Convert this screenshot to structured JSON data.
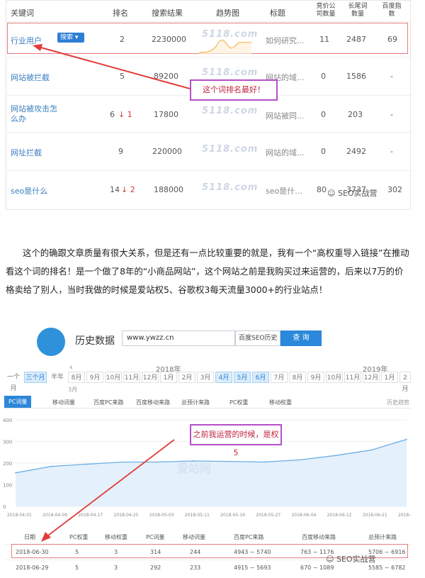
{
  "keyword_table": {
    "headers": [
      "关键词",
      "排名",
      "搜索结果",
      "趋势图",
      "标题",
      "竞价公司数量",
      "长尾词数量",
      "百度指数"
    ],
    "search_button": "搜索 ▾",
    "watermark": "5118.com",
    "rows": [
      {
        "keyword": "行业用户",
        "rank": "2",
        "change": "",
        "results": "2230000",
        "title": "如何研究...",
        "bid": "11",
        "longtail": "2487",
        "index": "69"
      },
      {
        "keyword": "网站被拦截",
        "rank": "5",
        "change": "",
        "results": "89200",
        "title": "网站的域...",
        "bid": "0",
        "longtail": "1586",
        "index": "-"
      },
      {
        "keyword": "网站被攻击怎么办",
        "rank": "6",
        "change": "↓ 1",
        "results": "17800",
        "title": "网站被同...",
        "bid": "0",
        "longtail": "203",
        "index": "-"
      },
      {
        "keyword": "网址拦截",
        "rank": "9",
        "change": "",
        "results": "220000",
        "title": "网站的域...",
        "bid": "0",
        "longtail": "2492",
        "index": "-"
      },
      {
        "keyword": "seo是什么",
        "rank": "14",
        "change": "↓ 2",
        "results": "188000",
        "title": "seo是什...",
        "bid": "80",
        "longtail": "3737",
        "index": "302"
      }
    ],
    "callout": "这个词排名最好！",
    "brand_watermark": "SEO实战营"
  },
  "paragraph": "这个的确跟文章质量有很大关系，但是还有一点比较重要的就是，我有一个“高权重导入链接”在推动看这个词的排名！是一个做了8年的“小商品网站”，这个网站之前是我购买过来运营的，后来以7万的价格卖给了别人，当时我做的时候是爱站权5、谷歌权3每天流量3000+的行业站点！",
  "history": {
    "title": "历史数据",
    "url": "www.ywzz.cn",
    "select": "百度SEO历史",
    "query_button": "查 询",
    "year_2018": "2018年",
    "year_2019": "2019年",
    "ranges": [
      "一个月",
      "三个月",
      "半年"
    ],
    "months": [
      "8月",
      "9月",
      "10月",
      "11月",
      "12月",
      "1月",
      "2月",
      "3月",
      "4月",
      "5月",
      "6月",
      "7月",
      "8月",
      "9月",
      "10月",
      "11月",
      "12月",
      "1月",
      "2月"
    ],
    "month_3": "3月",
    "tabs": [
      "PC词量",
      "移动词量",
      "百度PC来路",
      "百度移动来路",
      "总预计来路",
      "PC权重",
      "移动权重"
    ],
    "tab_right": "历史趋势",
    "callout": "之前我运营的时候，是权5",
    "watermark": "爱站网",
    "table_headers": [
      "日期",
      "PC权重",
      "移动权重",
      "PC词量",
      "移动词量",
      "百度PC来路",
      "百度移动来路",
      "总预计来路"
    ],
    "table_rows": [
      [
        "2018-06-30",
        "5",
        "3",
        "314",
        "244",
        "4943 ~ 5740",
        "763 ~ 1176",
        "5706 ~ 6916"
      ],
      [
        "2018-06-29",
        "5",
        "3",
        "292",
        "233",
        "4915 ~ 5693",
        "670 ~ 1089",
        "5585 ~ 6782"
      ]
    ]
  },
  "chart_data": {
    "type": "area",
    "title": "",
    "xlabel": "",
    "ylabel": "",
    "ylim": [
      0,
      400
    ],
    "yticks": [
      "0",
      "100",
      "200",
      "300",
      "400"
    ],
    "categories": [
      "2018-04-01",
      "2018-04-09",
      "2018-04-17",
      "2018-04-25",
      "2018-05-03",
      "2018-05-11",
      "2018-05-19",
      "2018-05-27",
      "2018-06-04",
      "2018-06-12",
      "2018-06-21",
      "2018-06-2"
    ],
    "values": [
      155,
      185,
      195,
      205,
      205,
      210,
      208,
      205,
      215,
      235,
      260,
      310
    ],
    "colors": {
      "line": "#6aaee6",
      "fill": "#e4f0fb"
    }
  }
}
